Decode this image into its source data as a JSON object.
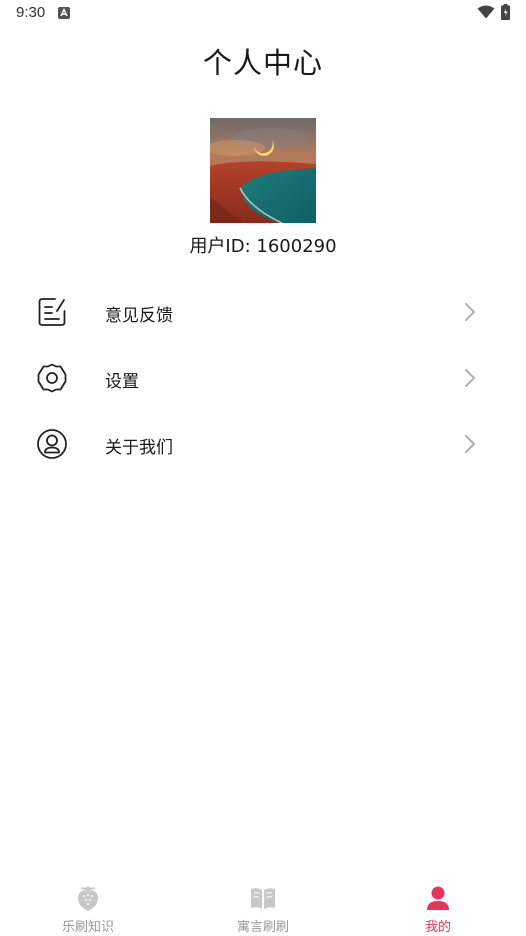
{
  "status_bar": {
    "time": "9:30"
  },
  "header": {
    "title": "个人中心"
  },
  "profile": {
    "user_id_text": "用户ID: 1600290"
  },
  "menu": {
    "items": [
      {
        "label": "意见反馈",
        "icon": "feedback-icon"
      },
      {
        "label": "设置",
        "icon": "settings-icon"
      },
      {
        "label": "关于我们",
        "icon": "about-us-icon"
      }
    ]
  },
  "bottom_nav": {
    "items": [
      {
        "label": "乐刷知识",
        "icon": "strawberry-icon",
        "active": false
      },
      {
        "label": "寓言刷刷",
        "icon": "book-icon",
        "active": false
      },
      {
        "label": "我的",
        "icon": "person-icon",
        "active": true
      }
    ]
  },
  "colors": {
    "accent": "#e8345a",
    "inactive": "#999999",
    "text": "#1a1a1a"
  }
}
